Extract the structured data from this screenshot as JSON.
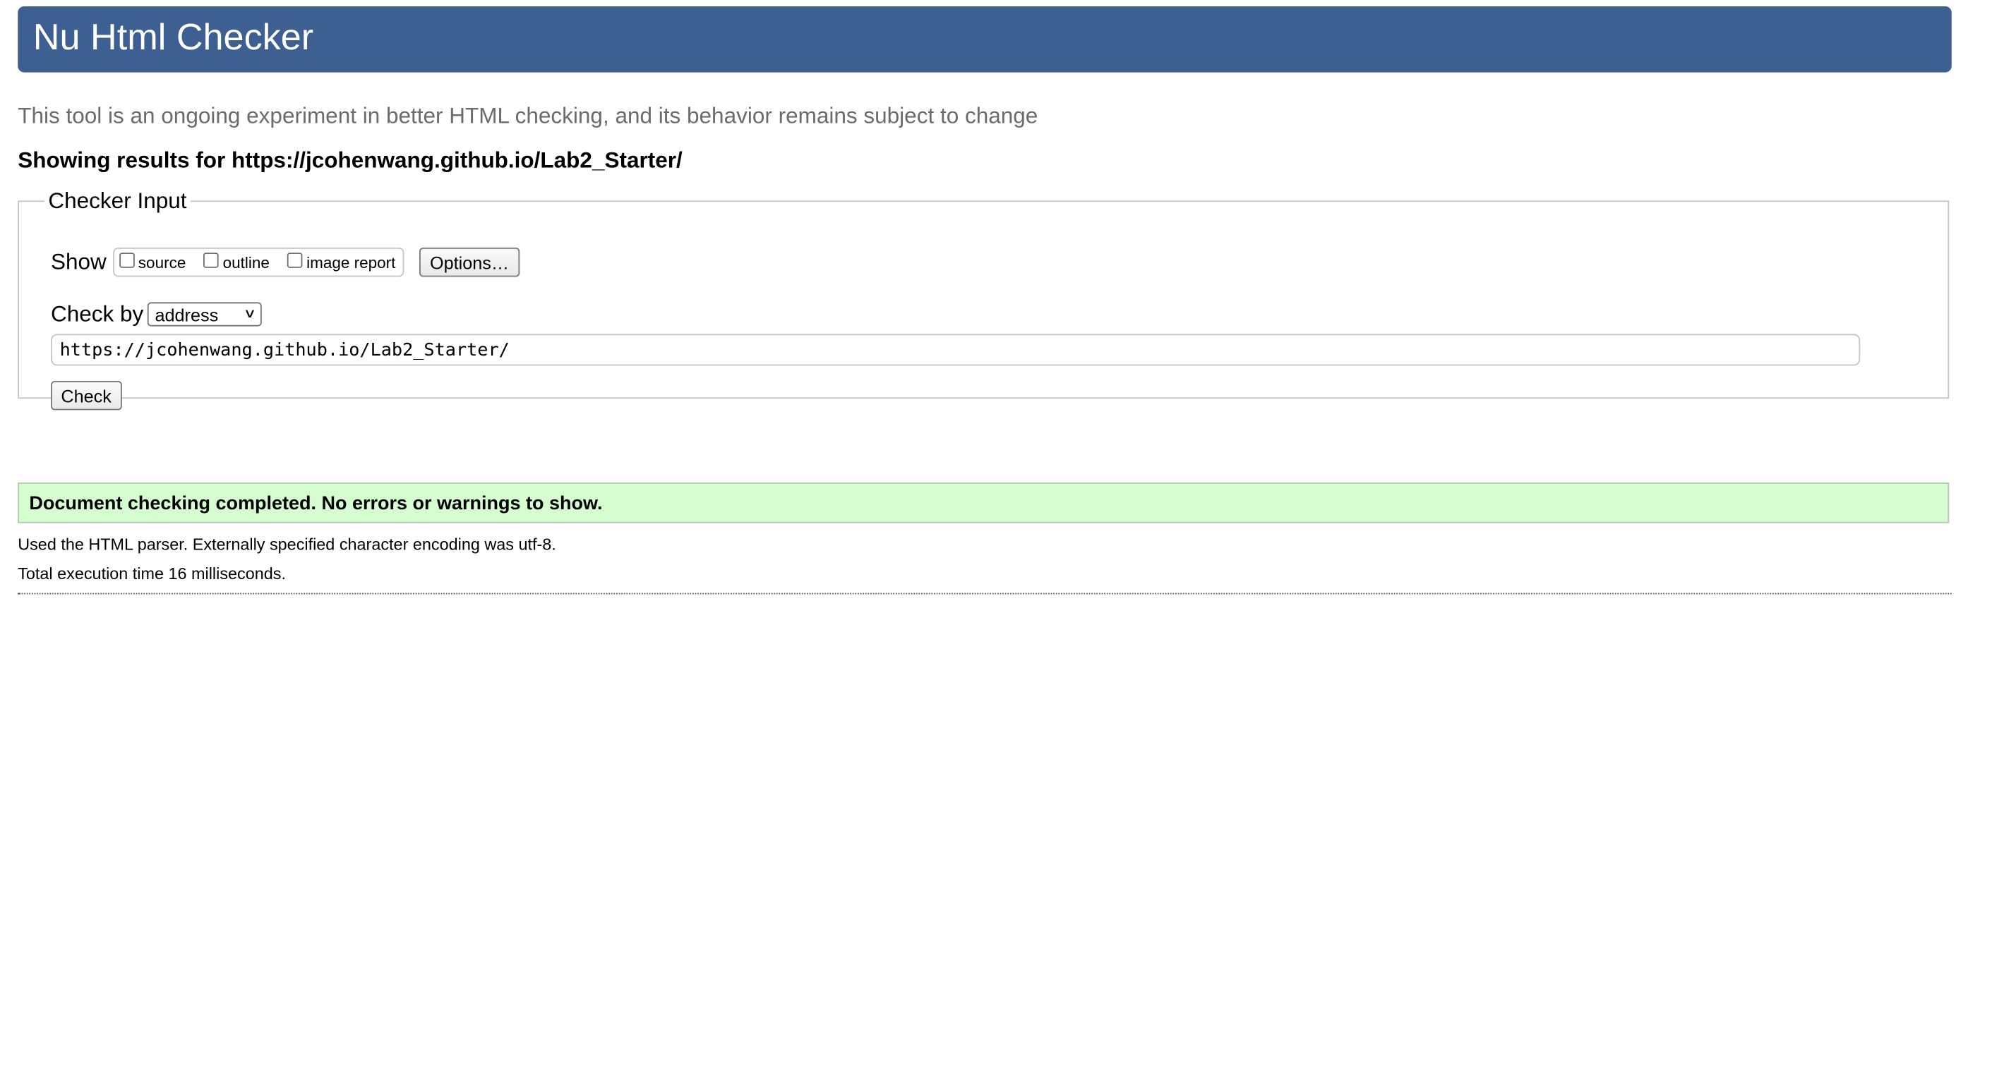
{
  "header": {
    "title": "Nu Html Checker"
  },
  "intro": "This tool is an ongoing experiment in better HTML checking, and its behavior remains subject to change",
  "results_for": "Showing results for https://jcohenwang.github.io/Lab2_Starter/",
  "checker": {
    "legend": "Checker Input",
    "show_label": "Show",
    "options": [
      {
        "label": "source",
        "checked": false
      },
      {
        "label": "outline",
        "checked": false
      },
      {
        "label": "image report",
        "checked": false
      }
    ],
    "options_button": "Options…",
    "check_by_label": "Check by",
    "check_by_value": "address",
    "url_value": "https://jcohenwang.github.io/Lab2_Starter/",
    "check_button": "Check"
  },
  "result": {
    "message": "Document checking completed. No errors or warnings to show.",
    "parser_note": "Used the HTML parser. Externally specified character encoding was utf-8.",
    "timing": "Total execution time 16 milliseconds."
  },
  "colors": {
    "header_bg": "#3e5f92",
    "success_bg": "#d5fdd0",
    "intro_text": "#6b6b6b"
  }
}
